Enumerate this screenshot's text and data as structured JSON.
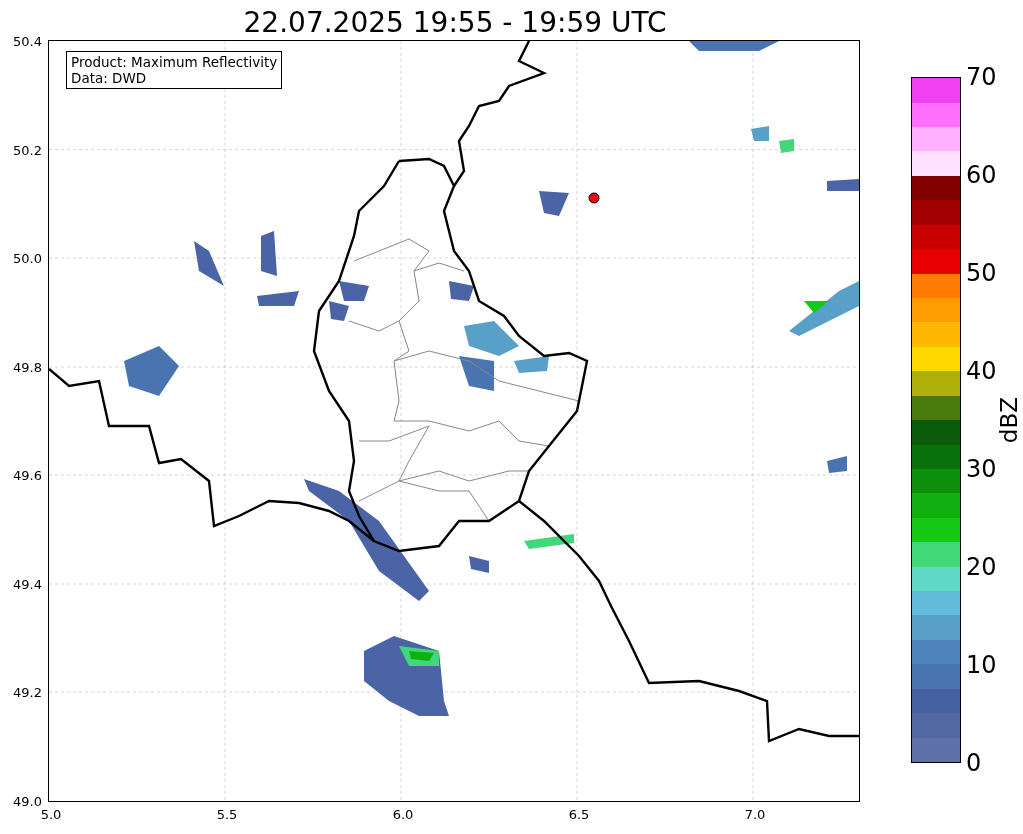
{
  "title": "22.07.2025 19:55 - 19:59 UTC",
  "map": {
    "info": [
      "Product: Maximum Reflectivity",
      "Data: DWD"
    ],
    "xticks": [
      "5.0",
      "5.5",
      "6.0",
      "6.5",
      "7.0"
    ],
    "yticks": [
      "50.4",
      "50.2",
      "50.0",
      "49.8",
      "49.6",
      "49.4",
      "49.2",
      "49.0"
    ]
  },
  "colorbar": {
    "label": "dBZ",
    "ticks": [
      "70",
      "60",
      "50",
      "40",
      "30",
      "20",
      "10",
      "0"
    ],
    "segments": [
      {
        "color": "#6070a8"
      },
      {
        "color": "#5468a4"
      },
      {
        "color": "#4460a0"
      },
      {
        "color": "#4a74b0"
      },
      {
        "color": "#4d84bc"
      },
      {
        "color": "#58a0c8"
      },
      {
        "color": "#60bcd8"
      },
      {
        "color": "#60d8c8"
      },
      {
        "color": "#40d878"
      },
      {
        "color": "#14c814"
      },
      {
        "color": "#10b010"
      },
      {
        "color": "#0c900c"
      },
      {
        "color": "#0a700a"
      },
      {
        "color": "#0a5c0a"
      },
      {
        "color": "#4a7a0a"
      },
      {
        "color": "#b0b00a"
      },
      {
        "color": "#ffd800"
      },
      {
        "color": "#ffb800"
      },
      {
        "color": "#ff9c00"
      },
      {
        "color": "#ff7c00"
      },
      {
        "color": "#e80000"
      },
      {
        "color": "#c80000"
      },
      {
        "color": "#a00000"
      },
      {
        "color": "#800000"
      },
      {
        "color": "#ffe0ff"
      },
      {
        "color": "#ffb0ff"
      },
      {
        "color": "#ff70ff"
      },
      {
        "color": "#f040f0"
      }
    ]
  }
}
